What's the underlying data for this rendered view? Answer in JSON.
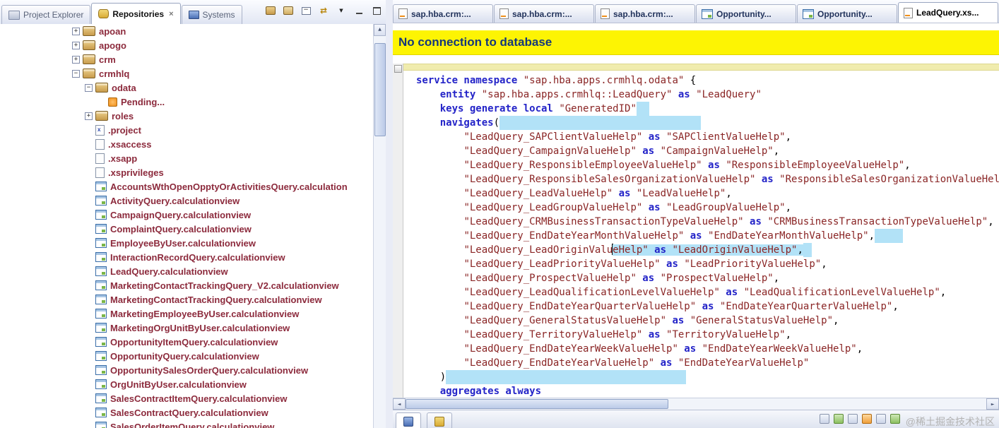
{
  "colors": {
    "chrome": "#e9ecf6",
    "banner-bg": "#fdf403",
    "banner-text": "#14377c",
    "keyword": "#2424c8",
    "string": "#8a2525",
    "tree-text": "#8c2a3c",
    "highlight": "#b2e2f7"
  },
  "left_panel": {
    "tabs": [
      {
        "label": "Project Explorer",
        "icon": "ti-explorer",
        "active": false,
        "closable": false
      },
      {
        "label": "Repositories",
        "icon": "ti-repositories",
        "active": true,
        "closable": true
      },
      {
        "label": "Systems",
        "icon": "ti-systems",
        "active": false,
        "closable": false
      }
    ],
    "tree": [
      {
        "label": "apoan",
        "level": 1,
        "expander": "+",
        "icon": "package"
      },
      {
        "label": "apogo",
        "level": 1,
        "expander": "+",
        "icon": "package"
      },
      {
        "label": "crm",
        "level": 1,
        "expander": "+",
        "icon": "package"
      },
      {
        "label": "crmhlq",
        "level": 1,
        "expander": "-",
        "icon": "package"
      },
      {
        "label": "odata",
        "level": 2,
        "expander": "-",
        "icon": "package"
      },
      {
        "label": "Pending...",
        "level": 3,
        "expander": null,
        "icon": "pending"
      },
      {
        "label": "roles",
        "level": 2,
        "expander": "+",
        "icon": "package"
      },
      {
        "label": ".project",
        "level": 2,
        "expander": null,
        "icon": "projectfile"
      },
      {
        "label": ".xsaccess",
        "level": 2,
        "expander": null,
        "icon": "file"
      },
      {
        "label": ".xsapp",
        "level": 2,
        "expander": null,
        "icon": "file"
      },
      {
        "label": ".xsprivileges",
        "level": 2,
        "expander": null,
        "icon": "file"
      },
      {
        "label": "AccountsWthOpenOpptyOrActivitiesQuery.calculation",
        "level": 2,
        "expander": null,
        "icon": "calcview"
      },
      {
        "label": "ActivityQuery.calculationview",
        "level": 2,
        "expander": null,
        "icon": "calcview"
      },
      {
        "label": "CampaignQuery.calculationview",
        "level": 2,
        "expander": null,
        "icon": "calcview"
      },
      {
        "label": "ComplaintQuery.calculationview",
        "level": 2,
        "expander": null,
        "icon": "calcview"
      },
      {
        "label": "EmployeeByUser.calculationview",
        "level": 2,
        "expander": null,
        "icon": "calcview"
      },
      {
        "label": "InteractionRecordQuery.calculationview",
        "level": 2,
        "expander": null,
        "icon": "calcview"
      },
      {
        "label": "LeadQuery.calculationview",
        "level": 2,
        "expander": null,
        "icon": "calcview"
      },
      {
        "label": "MarketingContactTrackingQuery_V2.calculationview",
        "level": 2,
        "expander": null,
        "icon": "calcview"
      },
      {
        "label": "MarketingContactTrackingQuery.calculationview",
        "level": 2,
        "expander": null,
        "icon": "calcview"
      },
      {
        "label": "MarketingEmployeeByUser.calculationview",
        "level": 2,
        "expander": null,
        "icon": "calcview"
      },
      {
        "label": "MarketingOrgUnitByUser.calculationview",
        "level": 2,
        "expander": null,
        "icon": "calcview"
      },
      {
        "label": "OpportunityItemQuery.calculationview",
        "level": 2,
        "expander": null,
        "icon": "calcview"
      },
      {
        "label": "OpportunityQuery.calculationview",
        "level": 2,
        "expander": null,
        "icon": "calcview"
      },
      {
        "label": "OpportunitySalesOrderQuery.calculationview",
        "level": 2,
        "expander": null,
        "icon": "calcview"
      },
      {
        "label": "OrgUnitByUser.calculationview",
        "level": 2,
        "expander": null,
        "icon": "calcview"
      },
      {
        "label": "SalesContractItemQuery.calculationview",
        "level": 2,
        "expander": null,
        "icon": "calcview"
      },
      {
        "label": "SalesContractQuery.calculationview",
        "level": 2,
        "expander": null,
        "icon": "calcview"
      },
      {
        "label": "SalesOrderItemQuery.calculationview",
        "level": 2,
        "expander": null,
        "icon": "calcview"
      }
    ]
  },
  "editor": {
    "banner": "No connection to database",
    "tabs": [
      {
        "label": "sap.hba.crm:...",
        "icon": "xsodata",
        "active": false
      },
      {
        "label": "sap.hba.crm:...",
        "icon": "xsodata",
        "active": false
      },
      {
        "label": "sap.hba.crm:...",
        "icon": "xsodata",
        "active": false
      },
      {
        "label": "Opportunity...",
        "icon": "calcview",
        "active": false
      },
      {
        "label": "Opportunity...",
        "icon": "calcview",
        "active": false
      },
      {
        "label": "LeadQuery.xs...",
        "icon": "xsodata",
        "active": true
      }
    ],
    "code_lines": [
      {
        "seg": [
          [
            "k",
            "service namespace"
          ],
          [
            "p",
            " "
          ],
          [
            "s",
            "\"sap.hba.apps.crmhlq.odata\""
          ],
          [
            "p",
            " {"
          ]
        ]
      },
      {
        "seg": [
          [
            "p",
            "    "
          ],
          [
            "k",
            "entity"
          ],
          [
            "p",
            " "
          ],
          [
            "s",
            "\"sap.hba.apps.crmhlq::LeadQuery\""
          ],
          [
            "k",
            " as "
          ],
          [
            "s",
            "\"LeadQuery\""
          ]
        ]
      },
      {
        "seg": [
          [
            "p",
            "    "
          ],
          [
            "k",
            "keys generate local"
          ],
          [
            "p",
            " "
          ],
          [
            "s",
            "\"GeneratedID\""
          ]
        ],
        "hl": 18
      },
      {
        "seg": [
          [
            "p",
            "    "
          ],
          [
            "k",
            "navigates"
          ],
          [
            "p",
            "("
          ]
        ],
        "hl": 285
      },
      {
        "seg": [
          [
            "p",
            "        "
          ],
          [
            "s",
            "\"LeadQuery_SAPClientValueHelp\""
          ],
          [
            "k",
            " as "
          ],
          [
            "s",
            "\"SAPClientValueHelp\""
          ],
          [
            "p",
            ","
          ]
        ]
      },
      {
        "seg": [
          [
            "p",
            "        "
          ],
          [
            "s",
            "\"LeadQuery_CampaignValueHelp\""
          ],
          [
            "k",
            " as "
          ],
          [
            "s",
            "\"CampaignValueHelp\""
          ],
          [
            "p",
            ","
          ]
        ]
      },
      {
        "seg": [
          [
            "p",
            "        "
          ],
          [
            "s",
            "\"LeadQuery_ResponsibleEmployeeValueHelp\""
          ],
          [
            "k",
            " as "
          ],
          [
            "s",
            "\"ResponsibleEmployeeValueHelp\""
          ],
          [
            "p",
            ","
          ]
        ]
      },
      {
        "seg": [
          [
            "p",
            "        "
          ],
          [
            "s",
            "\"LeadQuery_ResponsibleSalesOrganizationValueHelp\""
          ],
          [
            "k",
            " as "
          ],
          [
            "s",
            "\"ResponsibleSalesOrganizationValueHelp\""
          ],
          [
            "p",
            ","
          ]
        ]
      },
      {
        "seg": [
          [
            "p",
            "        "
          ],
          [
            "s",
            "\"LeadQuery_LeadValueHelp\""
          ],
          [
            "k",
            " as "
          ],
          [
            "s",
            "\"LeadValueHelp\""
          ],
          [
            "p",
            ","
          ]
        ]
      },
      {
        "seg": [
          [
            "p",
            "        "
          ],
          [
            "s",
            "\"LeadQuery_LeadGroupValueHelp\""
          ],
          [
            "k",
            " as "
          ],
          [
            "s",
            "\"LeadGroupValueHelp\""
          ],
          [
            "p",
            ","
          ]
        ]
      },
      {
        "seg": [
          [
            "p",
            "        "
          ],
          [
            "s",
            "\"LeadQuery_CRMBusinessTransactionTypeValueHelp\""
          ],
          [
            "k",
            " as "
          ],
          [
            "s",
            "\"CRMBusinessTransactionTypeValueHelp\""
          ],
          [
            "p",
            ","
          ]
        ]
      },
      {
        "seg": [
          [
            "p",
            "        "
          ],
          [
            "s",
            "\"LeadQuery_EndDateYearMonthValueHelp\""
          ],
          [
            "k",
            " as "
          ],
          [
            "s",
            "\"EndDateYearMonthValueHelp\""
          ],
          [
            "p",
            ","
          ]
        ],
        "hl": 40
      },
      {
        "seg": [
          [
            "p",
            "        "
          ],
          [
            "s",
            "\"LeadQuery_LeadOriginValu"
          ],
          [
            "caret",
            ""
          ],
          [
            "s",
            "eHelp\"",
            true
          ],
          [
            "k",
            " as ",
            true
          ],
          [
            "s",
            "\"LeadOriginValueHelp\"",
            true
          ],
          [
            "p",
            ",",
            true
          ]
        ],
        "hl": 12
      },
      {
        "seg": [
          [
            "p",
            "        "
          ],
          [
            "s",
            "\"LeadQuery_LeadPriorityValueHelp\""
          ],
          [
            "k",
            " as "
          ],
          [
            "s",
            "\"LeadPriorityValueHelp\""
          ],
          [
            "p",
            ","
          ]
        ]
      },
      {
        "seg": [
          [
            "p",
            "        "
          ],
          [
            "s",
            "\"LeadQuery_ProspectValueHelp\""
          ],
          [
            "k",
            " as "
          ],
          [
            "s",
            "\"ProspectValueHelp\""
          ],
          [
            "p",
            ","
          ]
        ]
      },
      {
        "seg": [
          [
            "p",
            "        "
          ],
          [
            "s",
            "\"LeadQuery_LeadQualificationLevelValueHelp\""
          ],
          [
            "k",
            " as "
          ],
          [
            "s",
            "\"LeadQualificationLevelValueHelp\""
          ],
          [
            "p",
            ","
          ]
        ]
      },
      {
        "seg": [
          [
            "p",
            "        "
          ],
          [
            "s",
            "\"LeadQuery_EndDateYearQuarterValueHelp\""
          ],
          [
            "k",
            " as "
          ],
          [
            "s",
            "\"EndDateYearQuarterValueHelp\""
          ],
          [
            "p",
            ","
          ]
        ]
      },
      {
        "seg": [
          [
            "p",
            "        "
          ],
          [
            "s",
            "\"LeadQuery_GeneralStatusValueHelp\""
          ],
          [
            "k",
            " as "
          ],
          [
            "s",
            "\"GeneralStatusValueHelp\""
          ],
          [
            "p",
            ","
          ]
        ]
      },
      {
        "seg": [
          [
            "p",
            "        "
          ],
          [
            "s",
            "\"LeadQuery_TerritoryValueHelp\""
          ],
          [
            "k",
            " as "
          ],
          [
            "s",
            "\"TerritoryValueHelp\""
          ],
          [
            "p",
            ","
          ]
        ]
      },
      {
        "seg": [
          [
            "p",
            "        "
          ],
          [
            "s",
            "\"LeadQuery_EndDateYearWeekValueHelp\""
          ],
          [
            "k",
            " as "
          ],
          [
            "s",
            "\"EndDateYearWeekValueHelp\""
          ],
          [
            "p",
            ","
          ]
        ]
      },
      {
        "seg": [
          [
            "p",
            "        "
          ],
          [
            "s",
            "\"LeadQuery_EndDateYearValueHelp\""
          ],
          [
            "k",
            " as "
          ],
          [
            "s",
            "\"EndDateYearValueHelp\""
          ]
        ]
      },
      {
        "seg": [
          [
            "p",
            "    )"
          ]
        ],
        "hl": 340
      },
      {
        "seg": [
          [
            "p",
            "    "
          ],
          [
            "k",
            "aggregates always"
          ]
        ]
      }
    ]
  },
  "watermark": "@稀土掘金技术社区"
}
